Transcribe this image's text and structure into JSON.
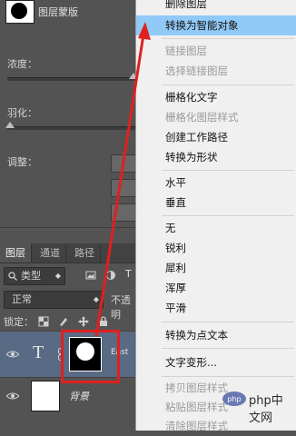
{
  "properties": {
    "mask_title": "图层蒙版",
    "density_label": "浓度：",
    "feather_label": "羽化：",
    "adjust_label": "调整："
  },
  "layers_panel": {
    "tabs": [
      {
        "label": "图层",
        "active": true
      },
      {
        "label": "通道",
        "active": false
      },
      {
        "label": "路径",
        "active": false
      }
    ],
    "filter": {
      "kind_label": "类型"
    },
    "blend_mode": "正常",
    "opacity_label": "不透明",
    "lock_label": "锁定：",
    "layers": [
      {
        "name": "East",
        "type": "text",
        "selected": true,
        "has_mask": true
      },
      {
        "name": "背景",
        "type": "background",
        "selected": false,
        "has_mask": false
      }
    ]
  },
  "context_menu": {
    "items": [
      {
        "label": "删除图层",
        "enabled": true,
        "highlighted": false
      },
      {
        "label": "转换为智能对象",
        "enabled": true,
        "highlighted": true
      },
      {
        "separator": true
      },
      {
        "label": "链接图层",
        "enabled": false,
        "highlighted": false
      },
      {
        "label": "选择链接图层",
        "enabled": false,
        "highlighted": false
      },
      {
        "separator": true
      },
      {
        "label": "栅格化文字",
        "enabled": true,
        "highlighted": false
      },
      {
        "label": "栅格化图层样式",
        "enabled": false,
        "highlighted": false
      },
      {
        "label": "创建工作路径",
        "enabled": true,
        "highlighted": false
      },
      {
        "label": "转换为形状",
        "enabled": true,
        "highlighted": false
      },
      {
        "separator": true
      },
      {
        "label": "水平",
        "enabled": true,
        "highlighted": false
      },
      {
        "label": "垂直",
        "enabled": true,
        "highlighted": false
      },
      {
        "separator": true
      },
      {
        "label": "无",
        "enabled": true,
        "highlighted": false
      },
      {
        "label": "锐利",
        "enabled": true,
        "highlighted": false
      },
      {
        "label": "犀利",
        "enabled": true,
        "highlighted": false
      },
      {
        "label": "浑厚",
        "enabled": true,
        "highlighted": false
      },
      {
        "label": "平滑",
        "enabled": true,
        "highlighted": false
      },
      {
        "separator": true
      },
      {
        "label": "转换为点文本",
        "enabled": true,
        "highlighted": false
      },
      {
        "separator": true
      },
      {
        "label": "文字变形...",
        "enabled": true,
        "highlighted": false
      },
      {
        "separator": true
      },
      {
        "label": "拷贝图层样式",
        "enabled": false,
        "highlighted": false
      },
      {
        "label": "粘贴图层样式",
        "enabled": false,
        "highlighted": false
      },
      {
        "label": "清除图层样式",
        "enabled": false,
        "highlighted": false
      }
    ]
  },
  "watermark": {
    "text": "php中文网"
  },
  "colors": {
    "panel_bg": "#535353",
    "menu_bg": "#f0f0f0",
    "highlight": "#91c9f7",
    "selected_layer": "#596a84",
    "annotation_red": "#e02020"
  }
}
